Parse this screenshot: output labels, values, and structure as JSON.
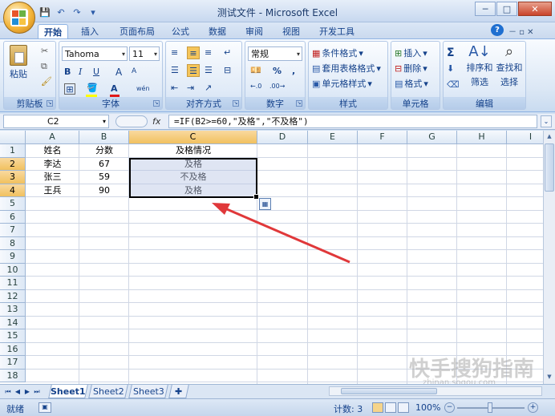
{
  "window": {
    "title": "测试文件 - Microsoft Excel",
    "controls": {
      "minimize": "─",
      "maximize": "□",
      "close": "✕"
    }
  },
  "qat": {
    "save_icon": "💾",
    "undo_icon": "↶",
    "redo_icon": "↷",
    "more_icon": "▾"
  },
  "tabs": [
    {
      "label": "开始",
      "active": true
    },
    {
      "label": "插入"
    },
    {
      "label": "页面布局"
    },
    {
      "label": "公式"
    },
    {
      "label": "数据"
    },
    {
      "label": "审阅"
    },
    {
      "label": "视图"
    },
    {
      "label": "开发工具"
    }
  ],
  "help_icon": "?",
  "ribbon_right_ctrls": "－ ▫ ✕",
  "ribbon": {
    "clipboard": {
      "label": "剪贴板",
      "paste": "粘贴"
    },
    "font": {
      "label": "字体",
      "name": "Tahoma",
      "size": "11",
      "bold": "B",
      "italic": "I",
      "underline": "U",
      "grow": "A",
      "shrink": "A",
      "font_color": "A",
      "wen": "wén"
    },
    "alignment": {
      "label": "对齐方式"
    },
    "number": {
      "label": "数字",
      "format": "常规",
      "percent": "%",
      "comma": ","
    },
    "styles": {
      "label": "样式",
      "cond": "条件格式",
      "table": "套用表格格式",
      "cell": "单元格样式"
    },
    "cells": {
      "label": "单元格",
      "insert": "插入",
      "delete": "删除",
      "format": "格式"
    },
    "editing": {
      "label": "编辑",
      "sum": "Σ",
      "sort": "排序和",
      "sort2": "筛选",
      "find": "查找和",
      "find2": "选择"
    }
  },
  "formula_bar": {
    "name_box": "C2",
    "fx": "fx",
    "formula": "=IF(B2>=60,\"及格\",\"不及格\")"
  },
  "columns": [
    "A",
    "B",
    "C",
    "D",
    "E",
    "F",
    "G",
    "H",
    "I"
  ],
  "rows": [
    "1",
    "2",
    "3",
    "4",
    "5",
    "6",
    "7",
    "8",
    "9",
    "10",
    "11",
    "12",
    "13",
    "14",
    "15",
    "16",
    "17",
    "18"
  ],
  "cells": [
    {
      "a": "姓名",
      "b": "分数",
      "c": "及格情况"
    },
    {
      "a": "李达",
      "b": "67",
      "c": "及格"
    },
    {
      "a": "张三",
      "b": "59",
      "c": "不及格"
    },
    {
      "a": "王兵",
      "b": "90",
      "c": "及格"
    }
  ],
  "sheets": [
    "Sheet1",
    "Sheet2",
    "Sheet3"
  ],
  "status": {
    "ready": "就绪",
    "count": "计数: 3",
    "zoom": "100%"
  },
  "watermark": {
    "text": "快手搜狗指南",
    "url": "zhinan.sogou.com"
  },
  "colors": {
    "accent": "#15428b",
    "arrow": "#e0383a",
    "selection": "#b7c6e4"
  }
}
